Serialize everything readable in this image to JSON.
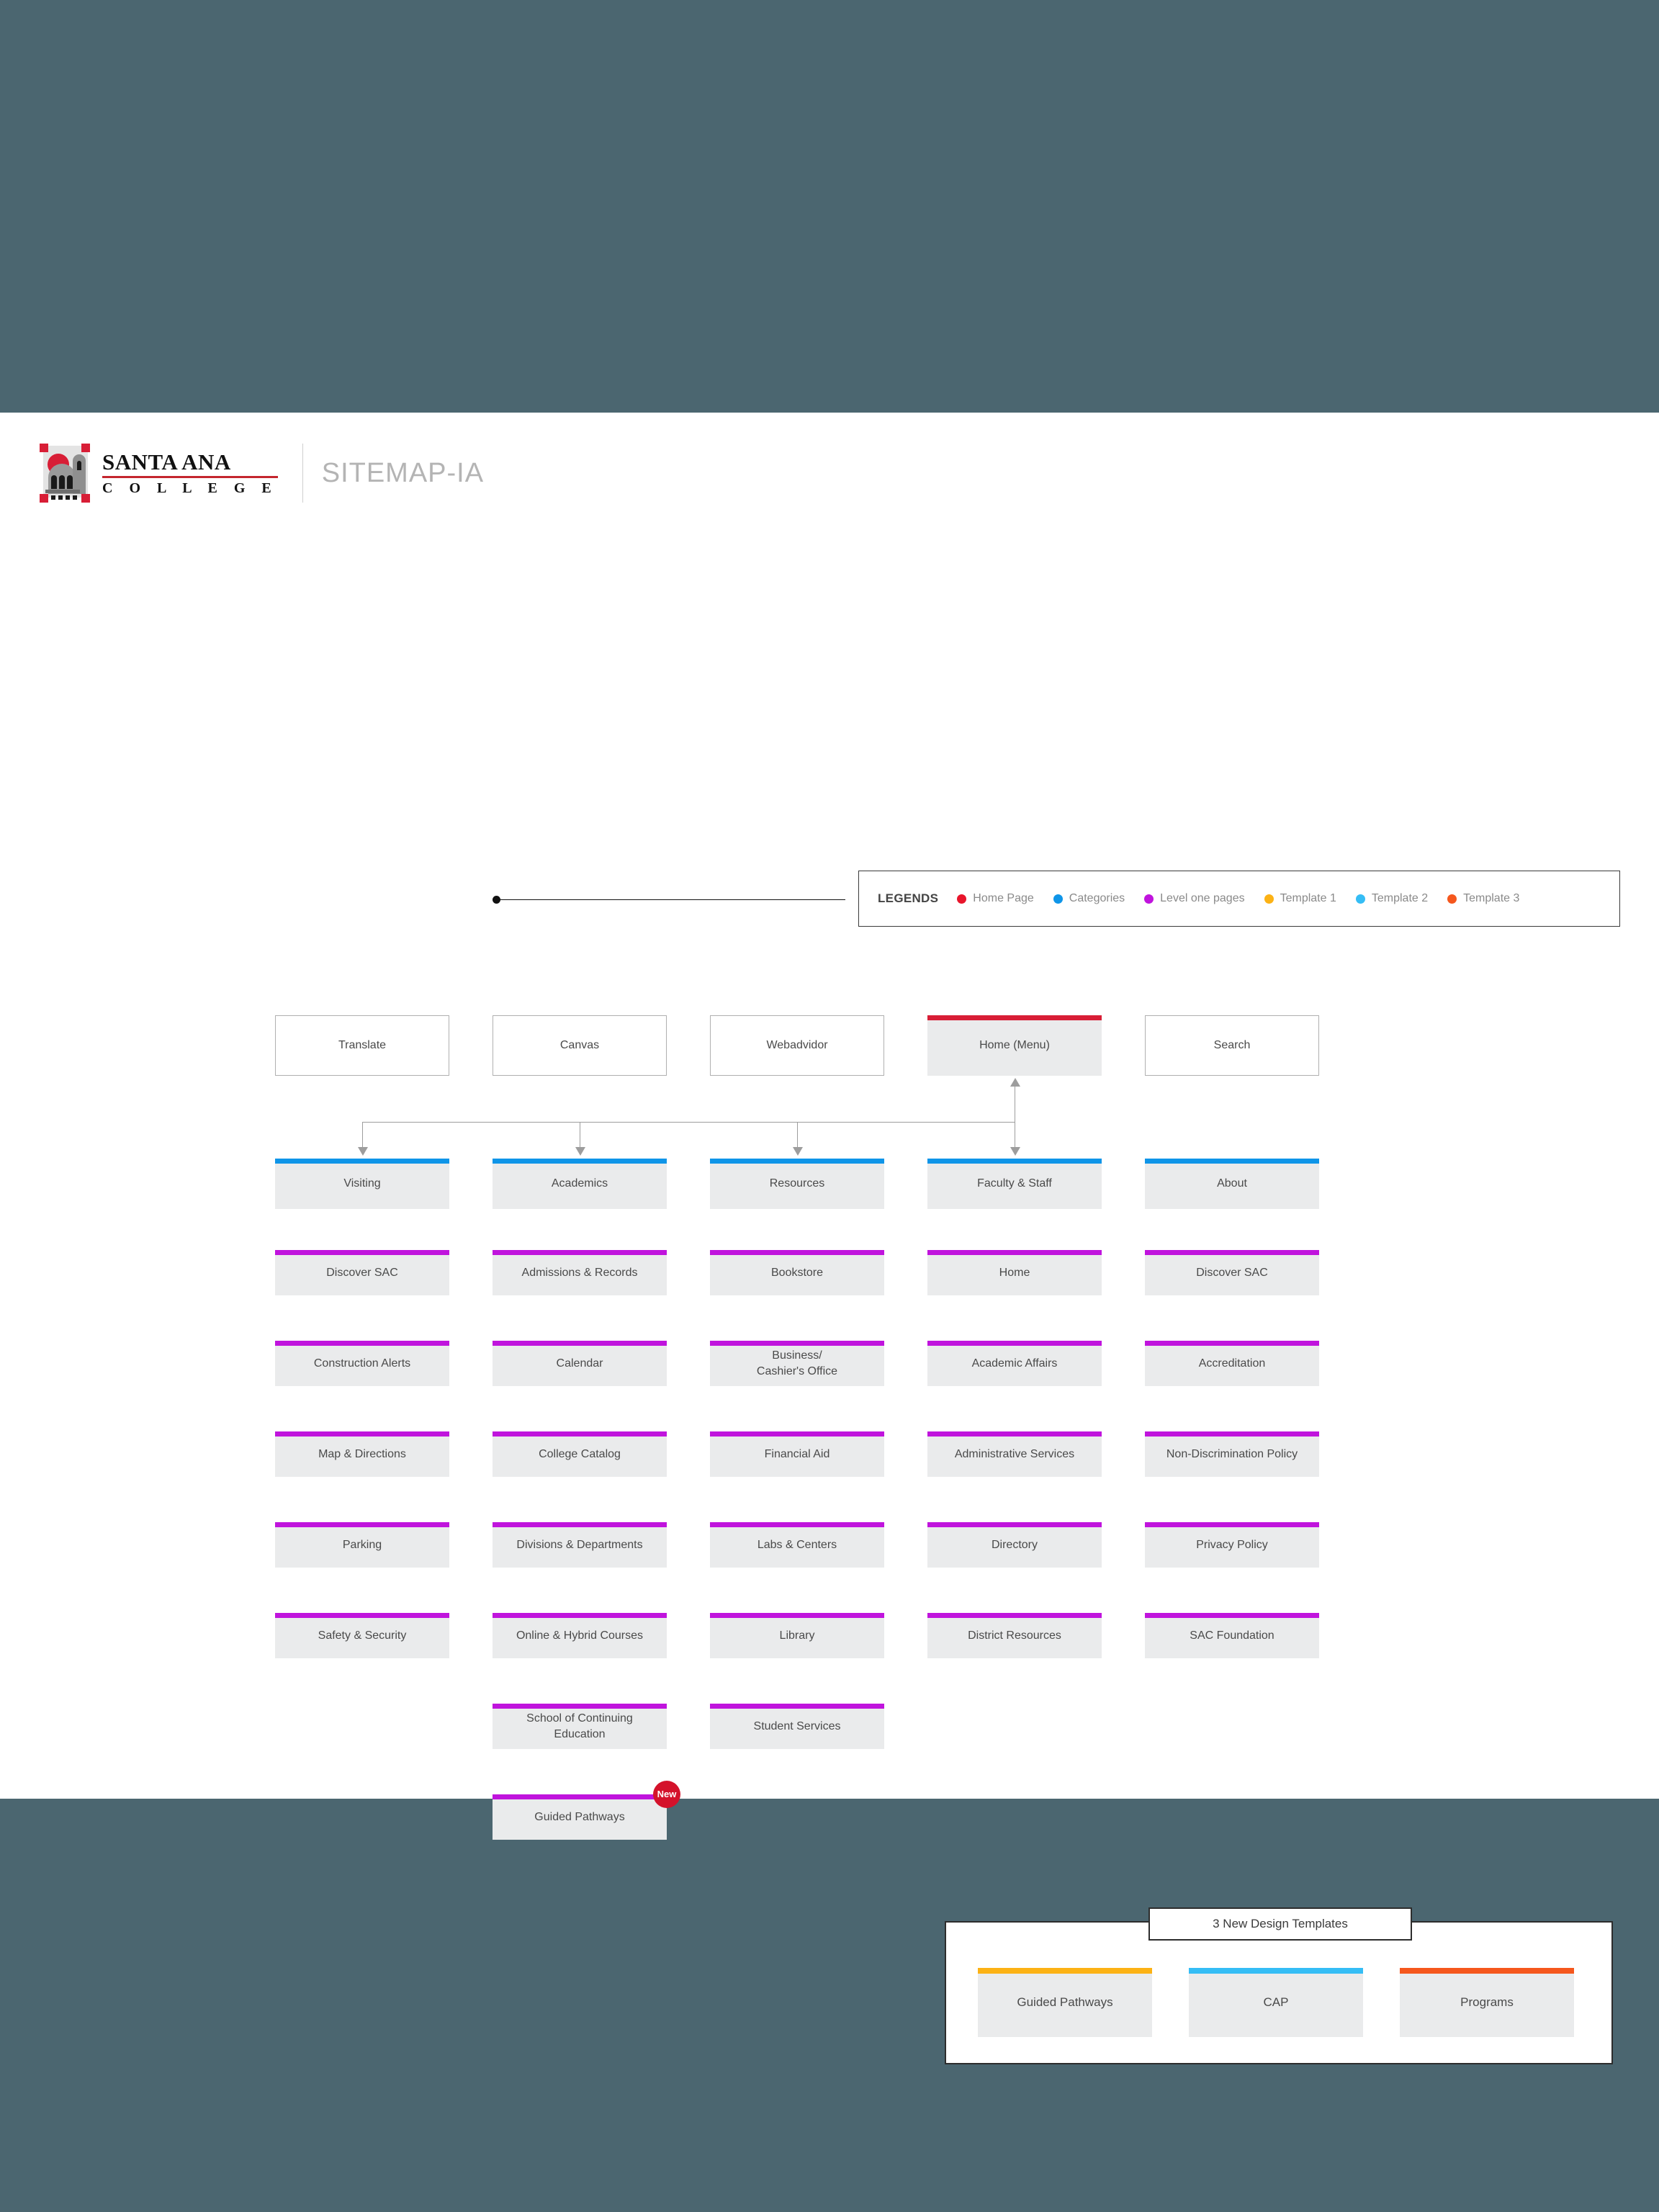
{
  "page": {
    "background_color": "#4b6670",
    "sheet_color": "#ffffff"
  },
  "header": {
    "logo_line1": "SANTA ANA",
    "logo_line2": "C O L L E G E",
    "title": "SITEMAP-IA"
  },
  "legend": {
    "title": "LEGENDS",
    "items": [
      {
        "label": "Home Page",
        "color": "#e8152b"
      },
      {
        "label": "Categories",
        "color": "#0f95e8"
      },
      {
        "label": "Level one pages",
        "color": "#c014dd"
      },
      {
        "label": "Template 1",
        "color": "#fcb215"
      },
      {
        "label": "Template 2",
        "color": "#35bdf5"
      },
      {
        "label": "Template 3",
        "color": "#f5571d"
      }
    ]
  },
  "colors": {
    "home": "#d81e36",
    "category": "#0f95e8",
    "level_one": "#c014dd",
    "template_1": "#fcb215",
    "template_2": "#35bdf5",
    "template_3": "#f5571d"
  },
  "utility_row": [
    {
      "label": "Translate",
      "style": "plain"
    },
    {
      "label": "Canvas",
      "style": "plain"
    },
    {
      "label": "Webadvidor",
      "style": "plain"
    },
    {
      "label": "Home (Menu)",
      "style": "home"
    },
    {
      "label": "Search",
      "style": "plain"
    }
  ],
  "columns": [
    {
      "category": "Visiting",
      "pages": [
        "Discover SAC",
        "Construction Alerts",
        "Map & Directions",
        "Parking",
        "Safety & Security"
      ]
    },
    {
      "category": "Academics",
      "pages": [
        "Admissions & Records",
        "Calendar",
        "College Catalog",
        "Divisions & Departments",
        "Online & Hybrid Courses",
        "School of Continuing Education",
        "Guided Pathways"
      ],
      "badge": {
        "index": 6,
        "label": "New"
      }
    },
    {
      "category": "Resources",
      "pages": [
        "Bookstore",
        "Business/\nCashier's Office",
        "Financial Aid",
        "Labs & Centers",
        "Library",
        "Student Services"
      ]
    },
    {
      "category": "Faculty & Staff",
      "pages": [
        "Home",
        "Academic Affairs",
        "Administrative Services",
        "Directory",
        "District Resources"
      ]
    },
    {
      "category": "About",
      "pages": [
        "Discover SAC",
        "Accreditation",
        "Non-Discrimination Policy",
        "Privacy Policy",
        "SAC Foundation"
      ]
    }
  ],
  "templates_panel": {
    "title": "3 New Design Templates",
    "items": [
      {
        "label": "Guided Pathways",
        "color": "#fcb215"
      },
      {
        "label": "CAP",
        "color": "#35bdf5"
      },
      {
        "label": "Programs",
        "color": "#f5571d"
      }
    ]
  }
}
